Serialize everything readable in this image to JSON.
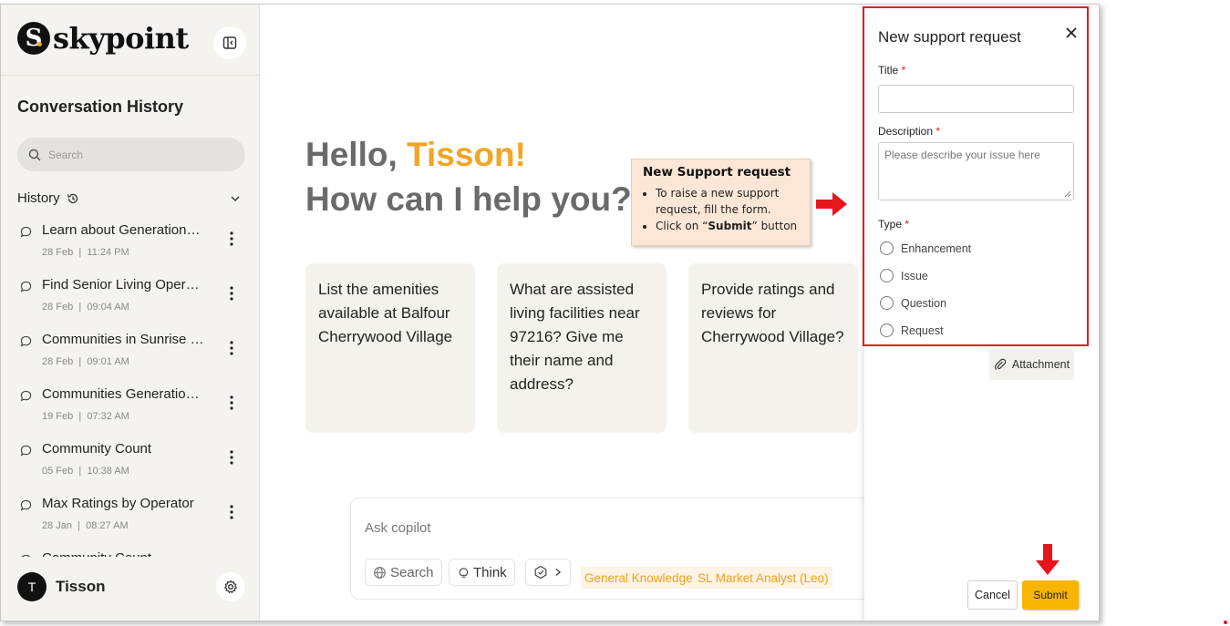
{
  "brand": {
    "name": "skypoint",
    "mark": "S"
  },
  "sidebar": {
    "title": "Conversation History",
    "search_placeholder": "Search",
    "history_label": "History",
    "items": [
      {
        "title": "Learn about Generations…",
        "date": "28 Feb",
        "time": "11:24 PM"
      },
      {
        "title": "Find Senior Living Opera…",
        "date": "28 Feb",
        "time": "09:04 AM"
      },
      {
        "title": "Communities in Sunrise …",
        "date": "28 Feb",
        "time": "09:01 AM"
      },
      {
        "title": "Communities Generatio…",
        "date": "19 Feb",
        "time": "07:32 AM"
      },
      {
        "title": "Community Count",
        "date": "05 Feb",
        "time": "10:38 AM"
      },
      {
        "title": "Max Ratings by Operator",
        "date": "28 Jan",
        "time": "08:27 AM"
      },
      {
        "title": "Community Count",
        "date": "",
        "time": ""
      }
    ],
    "user": {
      "initial": "T",
      "name": "Tisson"
    }
  },
  "main": {
    "greeting_prefix": "Hello, ",
    "greeting_name": "Tisson!",
    "subheading": "How can I help you?",
    "cards": [
      "List the amenities available at Balfour Cherrywood Village",
      "What are assisted living facilities near 97216? Give me their name and address?",
      "Provide ratings and reviews for Cherrywood Village?"
    ],
    "composer": {
      "placeholder": "Ask copilot",
      "search_label": "Search",
      "think_label": "Think",
      "tags": [
        "General Knowledge",
        "SL Market Analyst (Leo)"
      ]
    }
  },
  "callout": {
    "title": "New Support request",
    "bullet1": "To raise a new support request, fill the form.",
    "bullet2_pre": "Click on “",
    "bullet2_bold": "Submit",
    "bullet2_post": "” button"
  },
  "panel": {
    "title": "New support request",
    "title_label": "Title",
    "desc_label": "Description",
    "desc_placeholder": "Please describe your issue here",
    "type_label": "Type",
    "required_mark": "*",
    "types": [
      "Enhancement",
      "Issue",
      "Question",
      "Request"
    ],
    "attachment_label": "Attachment",
    "cancel_label": "Cancel",
    "submit_label": "Submit"
  },
  "colors": {
    "accent": "#f0a524",
    "submit": "#f7b500",
    "annotation": "#e8151c"
  }
}
